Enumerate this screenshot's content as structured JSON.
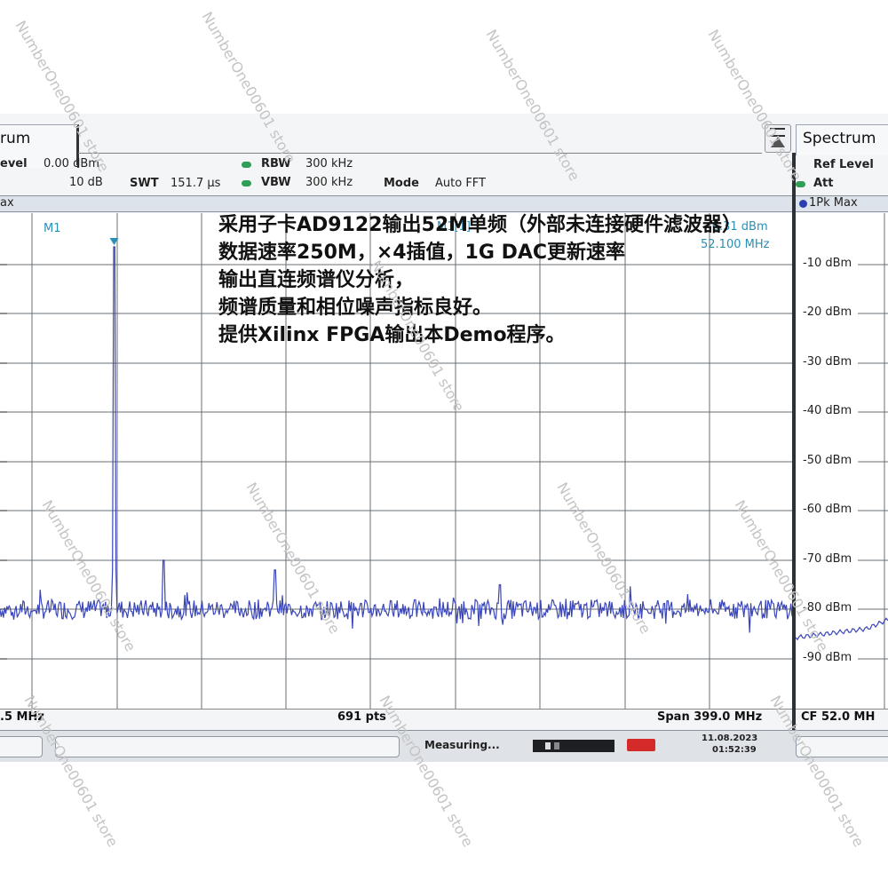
{
  "left_panel": {
    "tab_title": "rum",
    "ref_level_label": "evel",
    "ref_level_value": "0.00 dBm",
    "att_value": "10 dB",
    "swt_label": "SWT",
    "swt_value": "151.7 µs",
    "rbw_label": "RBW",
    "rbw_value": "300 kHz",
    "vbw_label": "VBW",
    "vbw_value": "300 kHz",
    "mode_label": "Mode",
    "mode_value": "Auto FFT",
    "trace_label": "ax",
    "marker_name": "M1",
    "marker_readout_label": "M1[1]",
    "marker_level": "-6.31 dBm",
    "marker_freq": "52.100 MHz",
    "start_freq": ".5 MHz",
    "points": "691 pts",
    "span": "Span 399.0 MHz"
  },
  "right_panel": {
    "tab_title": "Spectrum",
    "ref_level_label": "Ref Level",
    "att_label": "Att",
    "trace_label": "1Pk Max",
    "y_ticks": [
      "-10 dBm",
      "-20 dBm",
      "-30 dBm",
      "-40 dBm",
      "-50 dBm",
      "-60 dBm",
      "-70 dBm",
      "-80 dBm",
      "-90 dBm"
    ],
    "cf": "CF 52.0 MH"
  },
  "status_bar": {
    "measuring": "Measuring...",
    "date": "11.08.2023",
    "time": "01:52:39"
  },
  "overlay_text": "采用子卡AD9122输出52M单频（外部未连接硬件滤波器）\n数据速率250M，×4插值，1G DAC更新速率\n输出直连频谱仪分析，\n频谱质量和相位噪声指标良好。\n提供Xilinx FPGA输出本Demo程序。",
  "watermark": "NumberOne00601 store",
  "colors": {
    "trace": "#3a46b8",
    "marker": "#2a8fb5",
    "grid": "#6a6f75",
    "led_green": "#2f9e57",
    "frame": "#14181c"
  },
  "chart_data": {
    "type": "line",
    "title": "",
    "xlabel": "",
    "ylabel": "",
    "y_unit": "dBm",
    "ylim": [
      -100,
      0
    ],
    "points": 691,
    "span": "399.0 MHz",
    "noise_floor_dbm": -80,
    "series": [
      {
        "peaks": [
          {
            "freq_mhz": 52.1,
            "level_dbm": -6.31,
            "marker": "M1"
          }
        ]
      }
    ]
  }
}
